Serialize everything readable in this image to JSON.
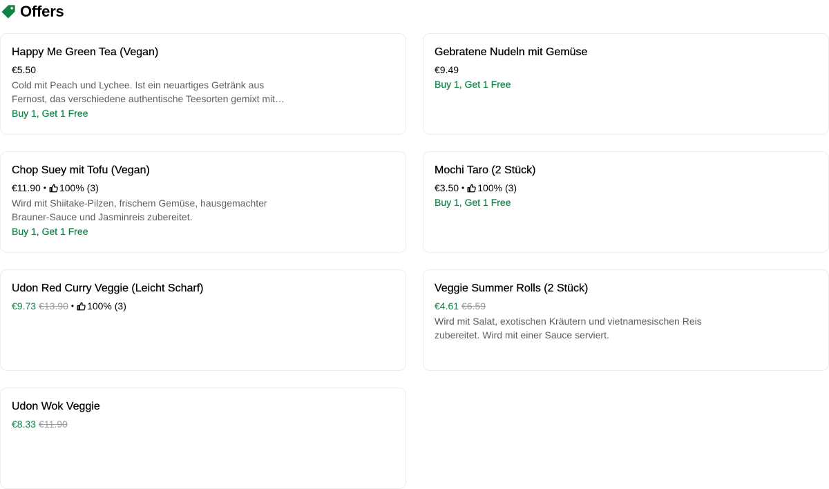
{
  "section": {
    "title": "Offers",
    "icon": "tag-icon",
    "accent_color": "#0e8345"
  },
  "offers": [
    {
      "title": "Happy Me Green Tea (Vegan)",
      "price": "€5.50",
      "description": "Cold mit Peach und Lychee. Ist ein neuartiges Getränk aus Fernost, das verschiedene authentische Teesorten gemixt mit…",
      "promo": "Buy 1, Get 1 Free"
    },
    {
      "title": "Gebratene Nudeln mit Gemüse",
      "price": "€9.49",
      "promo": "Buy 1, Get 1 Free"
    },
    {
      "title": "Chop Suey mit Tofu (Vegan)",
      "price": "€11.90",
      "rating": "100% (3)",
      "description": "Wird mit Shiitake-Pilzen, frischem Gemüse, hausgemachter Brauner-Sauce und Jasminreis zubereitet.",
      "promo": "Buy 1, Get 1 Free"
    },
    {
      "title": "Mochi Taro (2 Stück)",
      "price": "€3.50",
      "rating": "100% (3)",
      "promo": "Buy 1, Get 1 Free"
    },
    {
      "title": "Udon Red Curry Veggie (Leicht Scharf)",
      "discount_price": "€9.73",
      "original_price": "€13.90",
      "rating": "100% (3)"
    },
    {
      "title": "Veggie Summer Rolls (2 Stück)",
      "discount_price": "€4.61",
      "original_price": "€6.59",
      "description": "Wird mit Salat, exotischen Kräutern und vietnamesischen Reis zubereitet. Wird mit einer Sauce serviert."
    },
    {
      "title": "Udon Wok Veggie",
      "discount_price": "€8.33",
      "original_price": "€11.90"
    }
  ]
}
